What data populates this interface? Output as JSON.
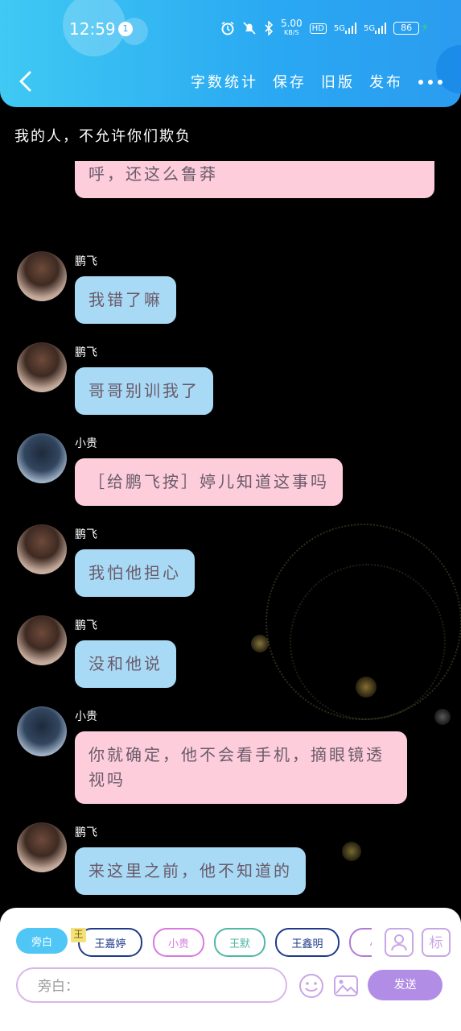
{
  "status_bar": {
    "time": "12:59",
    "notification_count": "1",
    "net_speed_value": "5.00",
    "net_speed_unit": "KB/S",
    "hd_label": "HD",
    "signal_1": "5G",
    "signal_2": "5G",
    "battery": "86"
  },
  "toolbar": {
    "word_count": "字数统计",
    "save": "保存",
    "old_version": "旧版",
    "publish": "发布"
  },
  "page_title": "我的人，不允许你们欺负",
  "messages": [
    {
      "sender": "",
      "side": "pink",
      "text": "你现在，除了你自己，还有婷儿得招呼，还这么鲁莽",
      "partial": true
    },
    {
      "sender": "鹏飞",
      "side": "blue",
      "text": "我错了嘛"
    },
    {
      "sender": "鹏飞",
      "side": "blue",
      "text": "哥哥别训我了"
    },
    {
      "sender": "小贵",
      "side": "pink",
      "text": "［给鹏飞按］婷儿知道这事吗"
    },
    {
      "sender": "鹏飞",
      "side": "blue",
      "text": "我怕他担心"
    },
    {
      "sender": "鹏飞",
      "side": "blue",
      "text": "没和他说"
    },
    {
      "sender": "小贵",
      "side": "pink",
      "text": "你就确定，他不会看手机，摘眼镜透视吗"
    },
    {
      "sender": "鹏飞",
      "side": "blue",
      "text": "来这里之前，他不知道的"
    }
  ],
  "characters": {
    "narrator": "旁白",
    "crown_badge": "王",
    "c1": "王嘉婷",
    "c2": "小贵",
    "c3": "王默",
    "c4": "王鑫明",
    "c5": "小"
  },
  "composer": {
    "placeholder": "旁白：",
    "send": "发送",
    "label_icon": "标"
  }
}
